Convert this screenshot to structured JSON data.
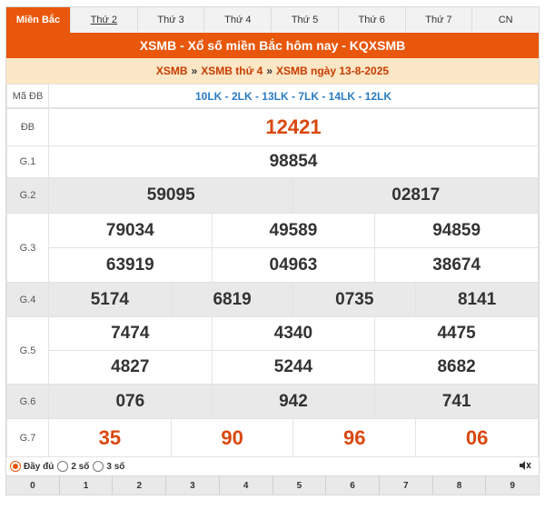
{
  "tabs": [
    {
      "label": "Miền Bắc"
    },
    {
      "label": "Thứ 2"
    },
    {
      "label": "Thứ 3"
    },
    {
      "label": "Thứ 4"
    },
    {
      "label": "Thứ 5"
    },
    {
      "label": "Thứ 6"
    },
    {
      "label": "Thứ 7"
    },
    {
      "label": "CN"
    }
  ],
  "title": "XSMB - Xổ số miền Bắc hôm nay - KQXSMB",
  "breadcrumb": {
    "item1": "XSMB",
    "sep1": "»",
    "item2": "XSMB thứ 4",
    "sep2": "»",
    "item3": "XSMB ngày 13-8-2025"
  },
  "ma_db": {
    "label": "Mã ĐB",
    "value": "10LK - 2LK - 13LK - 7LK - 14LK - 12LK"
  },
  "prizes": {
    "db": {
      "label": "ĐB",
      "values": [
        "12421"
      ]
    },
    "g1": {
      "label": "G.1",
      "values": [
        "98854"
      ]
    },
    "g2": {
      "label": "G.2",
      "values": [
        "59095",
        "02817"
      ]
    },
    "g3": {
      "label": "G.3",
      "values": [
        "79034",
        "49589",
        "94859",
        "63919",
        "04963",
        "38674"
      ]
    },
    "g4": {
      "label": "G.4",
      "values": [
        "5174",
        "6819",
        "0735",
        "8141"
      ]
    },
    "g5": {
      "label": "G.5",
      "values": [
        "7474",
        "4340",
        "4475",
        "4827",
        "5244",
        "8682"
      ]
    },
    "g6": {
      "label": "G.6",
      "values": [
        "076",
        "942",
        "741"
      ]
    },
    "g7": {
      "label": "G.7",
      "values": [
        "35",
        "90",
        "96",
        "06"
      ]
    }
  },
  "display_options": {
    "full": "Đầy đủ",
    "two": "2 số",
    "three": "3 số",
    "selected": "full"
  },
  "mute_icon": "speaker-muted-icon",
  "digits": [
    "0",
    "1",
    "2",
    "3",
    "4",
    "5",
    "6",
    "7",
    "8",
    "9"
  ],
  "colors": {
    "accent": "#e8570b",
    "code": "#2a7cc4",
    "special": "#d9480f"
  }
}
